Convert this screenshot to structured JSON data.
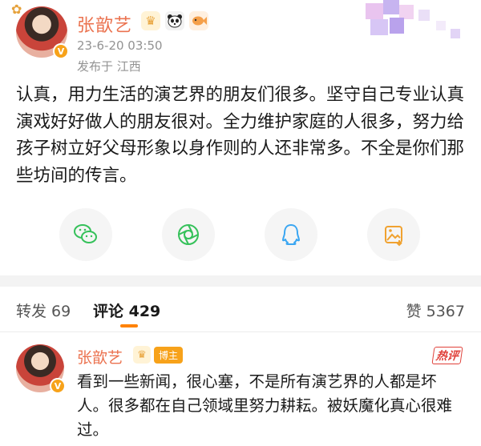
{
  "post": {
    "username": "张歆艺",
    "time": "23-6-20 03:50",
    "location": "发布于 江西",
    "content": "认真，用力生活的演艺界的朋友们很多。坚守自己专业认真演戏好好做人的朋友很对。全力维护家庭的人很多，努力给孩子树立好父母形象以身作则的人还非常多。不全是你们那些坊间的传言。",
    "verified_badge": "V",
    "badge_icons": [
      "crown-badge-icon",
      "panda-badge-icon",
      "fish-badge-icon"
    ]
  },
  "share": {
    "buttons": [
      "wechat-icon",
      "moments-icon",
      "qq-icon",
      "save-image-icon"
    ]
  },
  "tabs": {
    "repost": "转发 69",
    "comments": "评论 429",
    "likes": "赞 5367"
  },
  "comment": {
    "username": "张歆艺",
    "role_badge": "博主",
    "hot_label": "热评",
    "text": "看到一些新闻，很心塞，不是所有演艺界的人都是坏人。很多都在自己领域里努力耕耘。被妖魔化真心很难过。"
  },
  "colors": {
    "username": "#eb7350",
    "accent": "#ff8200",
    "hot": "#e0413a",
    "meta": "#939393"
  }
}
